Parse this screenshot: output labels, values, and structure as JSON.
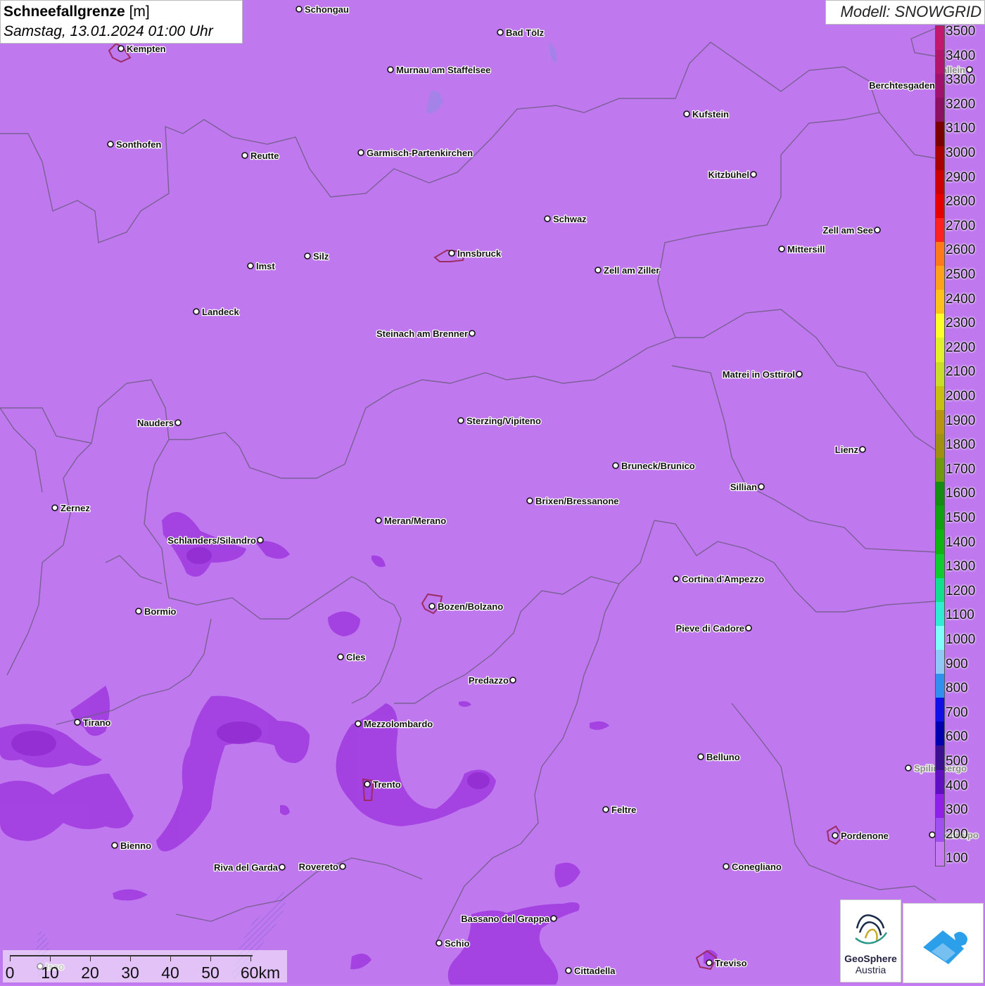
{
  "header": {
    "title_bold": "Schneefallgrenze",
    "title_unit": "[m]",
    "datetime": "Samstag, 13.01.2024 01:00 Uhr"
  },
  "model_label": "Modell: SNOWGRID",
  "legend": {
    "labels": [
      "3500",
      "3400",
      "3300",
      "3200",
      "3100",
      "3000",
      "2900",
      "2800",
      "2700",
      "2600",
      "2500",
      "2400",
      "2300",
      "2200",
      "2100",
      "2000",
      "1900",
      "1800",
      "1700",
      "1600",
      "1500",
      "1400",
      "1300",
      "1200",
      "1100",
      "1000",
      "900",
      "800",
      "700",
      "600",
      "500",
      "400",
      "300",
      "200",
      "100"
    ],
    "colors": [
      "#c2186e",
      "#b4156c",
      "#a0126b",
      "#8c0f60",
      "#7a0000",
      "#a80000",
      "#cc0000",
      "#e60000",
      "#ff2020",
      "#ff7a1a",
      "#ffa21a",
      "#ffc21a",
      "#ffff2a",
      "#e0f02a",
      "#c8dc28",
      "#c8c010",
      "#b89510",
      "#a09010",
      "#6e9a10",
      "#148c14",
      "#10a010",
      "#10b410",
      "#10cc30",
      "#10e090",
      "#30ecd2",
      "#80ffff",
      "#90c8f8",
      "#3090f0",
      "#1010e6",
      "#0000b0",
      "#3a1090",
      "#6010c0",
      "#9020e8",
      "#a050f0",
      "#c77cf3"
    ]
  },
  "scale": {
    "ticks": [
      "0",
      "10",
      "20",
      "30",
      "40",
      "50",
      "60km"
    ]
  },
  "logos": {
    "geosphere_name": "GeoSphere",
    "geosphere_sub": "Austria"
  },
  "cities": [
    {
      "name": "Schongau"
    },
    {
      "name": "Kempten"
    },
    {
      "name": "Bad Tölz"
    },
    {
      "name": "Murnau am Staffelsee"
    },
    {
      "name": "Hallein"
    },
    {
      "name": "Berchtesgaden"
    },
    {
      "name": "Kufstein"
    },
    {
      "name": "Sonthofen"
    },
    {
      "name": "Reutte"
    },
    {
      "name": "Garmisch-Partenkirchen"
    },
    {
      "name": "Kitzbühel"
    },
    {
      "name": "Schwaz"
    },
    {
      "name": "Zell am See"
    },
    {
      "name": "Innsbruck"
    },
    {
      "name": "Mittersill"
    },
    {
      "name": "Imst"
    },
    {
      "name": "Silz"
    },
    {
      "name": "Zell am Ziller"
    },
    {
      "name": "Landeck"
    },
    {
      "name": "Steinach am Brenner"
    },
    {
      "name": "Matrei in Osttirol"
    },
    {
      "name": "Nauders"
    },
    {
      "name": "Sterzing/Vipiteno"
    },
    {
      "name": "Lienz"
    },
    {
      "name": "Bruneck/Brunico"
    },
    {
      "name": "Sillian"
    },
    {
      "name": "Zernez"
    },
    {
      "name": "Brixen/Bressanone"
    },
    {
      "name": "Meran/Merano"
    },
    {
      "name": "Schlanders/Silandro"
    },
    {
      "name": "Cortina d'Ampezzo"
    },
    {
      "name": "Bozen/Bolzano"
    },
    {
      "name": "Bormio"
    },
    {
      "name": "Pieve di Cadore"
    },
    {
      "name": "Cles"
    },
    {
      "name": "Predazzo"
    },
    {
      "name": "Tirano"
    },
    {
      "name": "Mezzolombardo"
    },
    {
      "name": "Belluno"
    },
    {
      "name": "Spilimbergo"
    },
    {
      "name": "Trento"
    },
    {
      "name": "Feltre"
    },
    {
      "name": "Pordenone"
    },
    {
      "name": "Codroipo"
    },
    {
      "name": "Bienno"
    },
    {
      "name": "Riva del Garda"
    },
    {
      "name": "Rovereto"
    },
    {
      "name": "Conegliano"
    },
    {
      "name": "Bassano del Grappa"
    },
    {
      "name": "Schio"
    },
    {
      "name": "Iseo"
    },
    {
      "name": "Treviso"
    },
    {
      "name": "Cittadella"
    }
  ]
}
